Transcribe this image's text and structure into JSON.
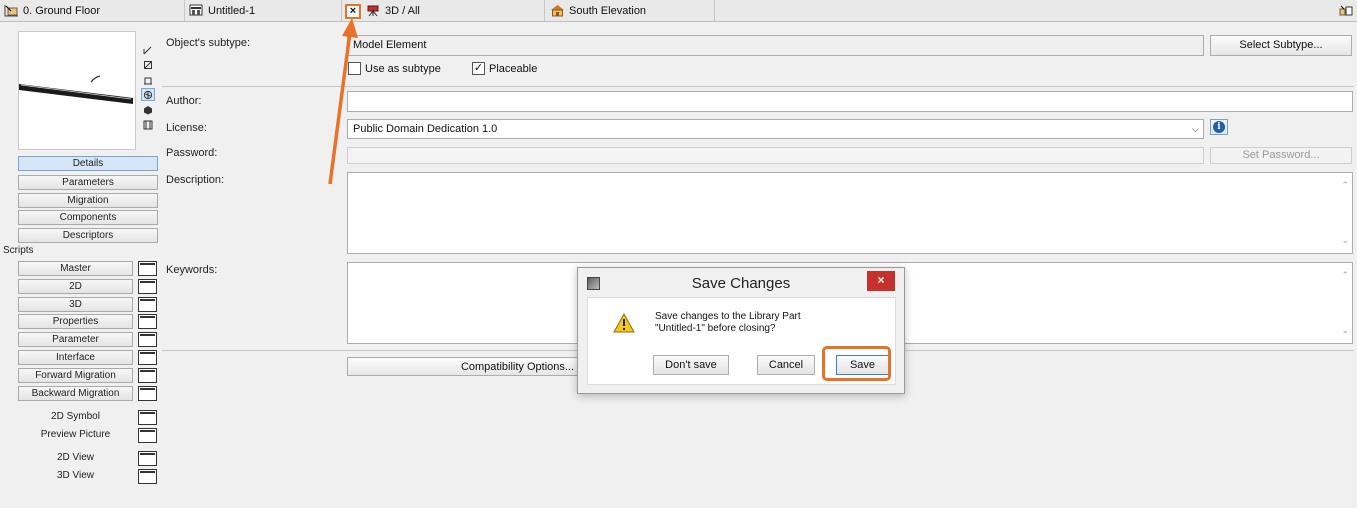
{
  "tabs": [
    {
      "label": "0. Ground Floor",
      "icon": "floor-plan-icon"
    },
    {
      "label": "Untitled-1",
      "icon": "library-part-icon"
    },
    {
      "label": "3D / All",
      "icon": "3d-view-icon"
    },
    {
      "label": "South Elevation",
      "icon": "elevation-icon"
    }
  ],
  "tab_close_symbol": "×",
  "left_panel": {
    "nav": [
      "Details",
      "Parameters",
      "Migration",
      "Components",
      "Descriptors"
    ],
    "scripts_label": "Scripts",
    "scripts": [
      "Master",
      "2D",
      "3D",
      "Properties",
      "Parameter",
      "Interface",
      "Forward Migration",
      "Backward Migration"
    ],
    "extras": [
      "2D Symbol",
      "Preview Picture",
      "2D View",
      "3D View"
    ]
  },
  "form": {
    "subtype_label": "Object's subtype:",
    "subtype_value": "Model Element",
    "select_subtype_button": "Select Subtype...",
    "use_as_subtype_label": "Use as subtype",
    "use_as_subtype_checked": false,
    "placeable_label": "Placeable",
    "placeable_checked": true,
    "author_label": "Author:",
    "author_value": "",
    "license_label": "License:",
    "license_value": "Public Domain Dedication 1.0",
    "password_label": "Password:",
    "set_password_button": "Set Password...",
    "description_label": "Description:",
    "description_value": "",
    "keywords_label": "Keywords:",
    "keywords_value": "",
    "compatibility_button": "Compatibility Options..."
  },
  "dialog": {
    "title": "Save Changes",
    "close_symbol": "×",
    "message_line1": "Save changes to the Library Part",
    "message_line2": "\"Untitled-1\" before closing?",
    "dont_save": "Don't save",
    "cancel": "Cancel",
    "save": "Save"
  },
  "colors": {
    "annotation": "#e8722a",
    "dialog_close": "#c7312b",
    "active_nav": "#d5e6f9"
  }
}
